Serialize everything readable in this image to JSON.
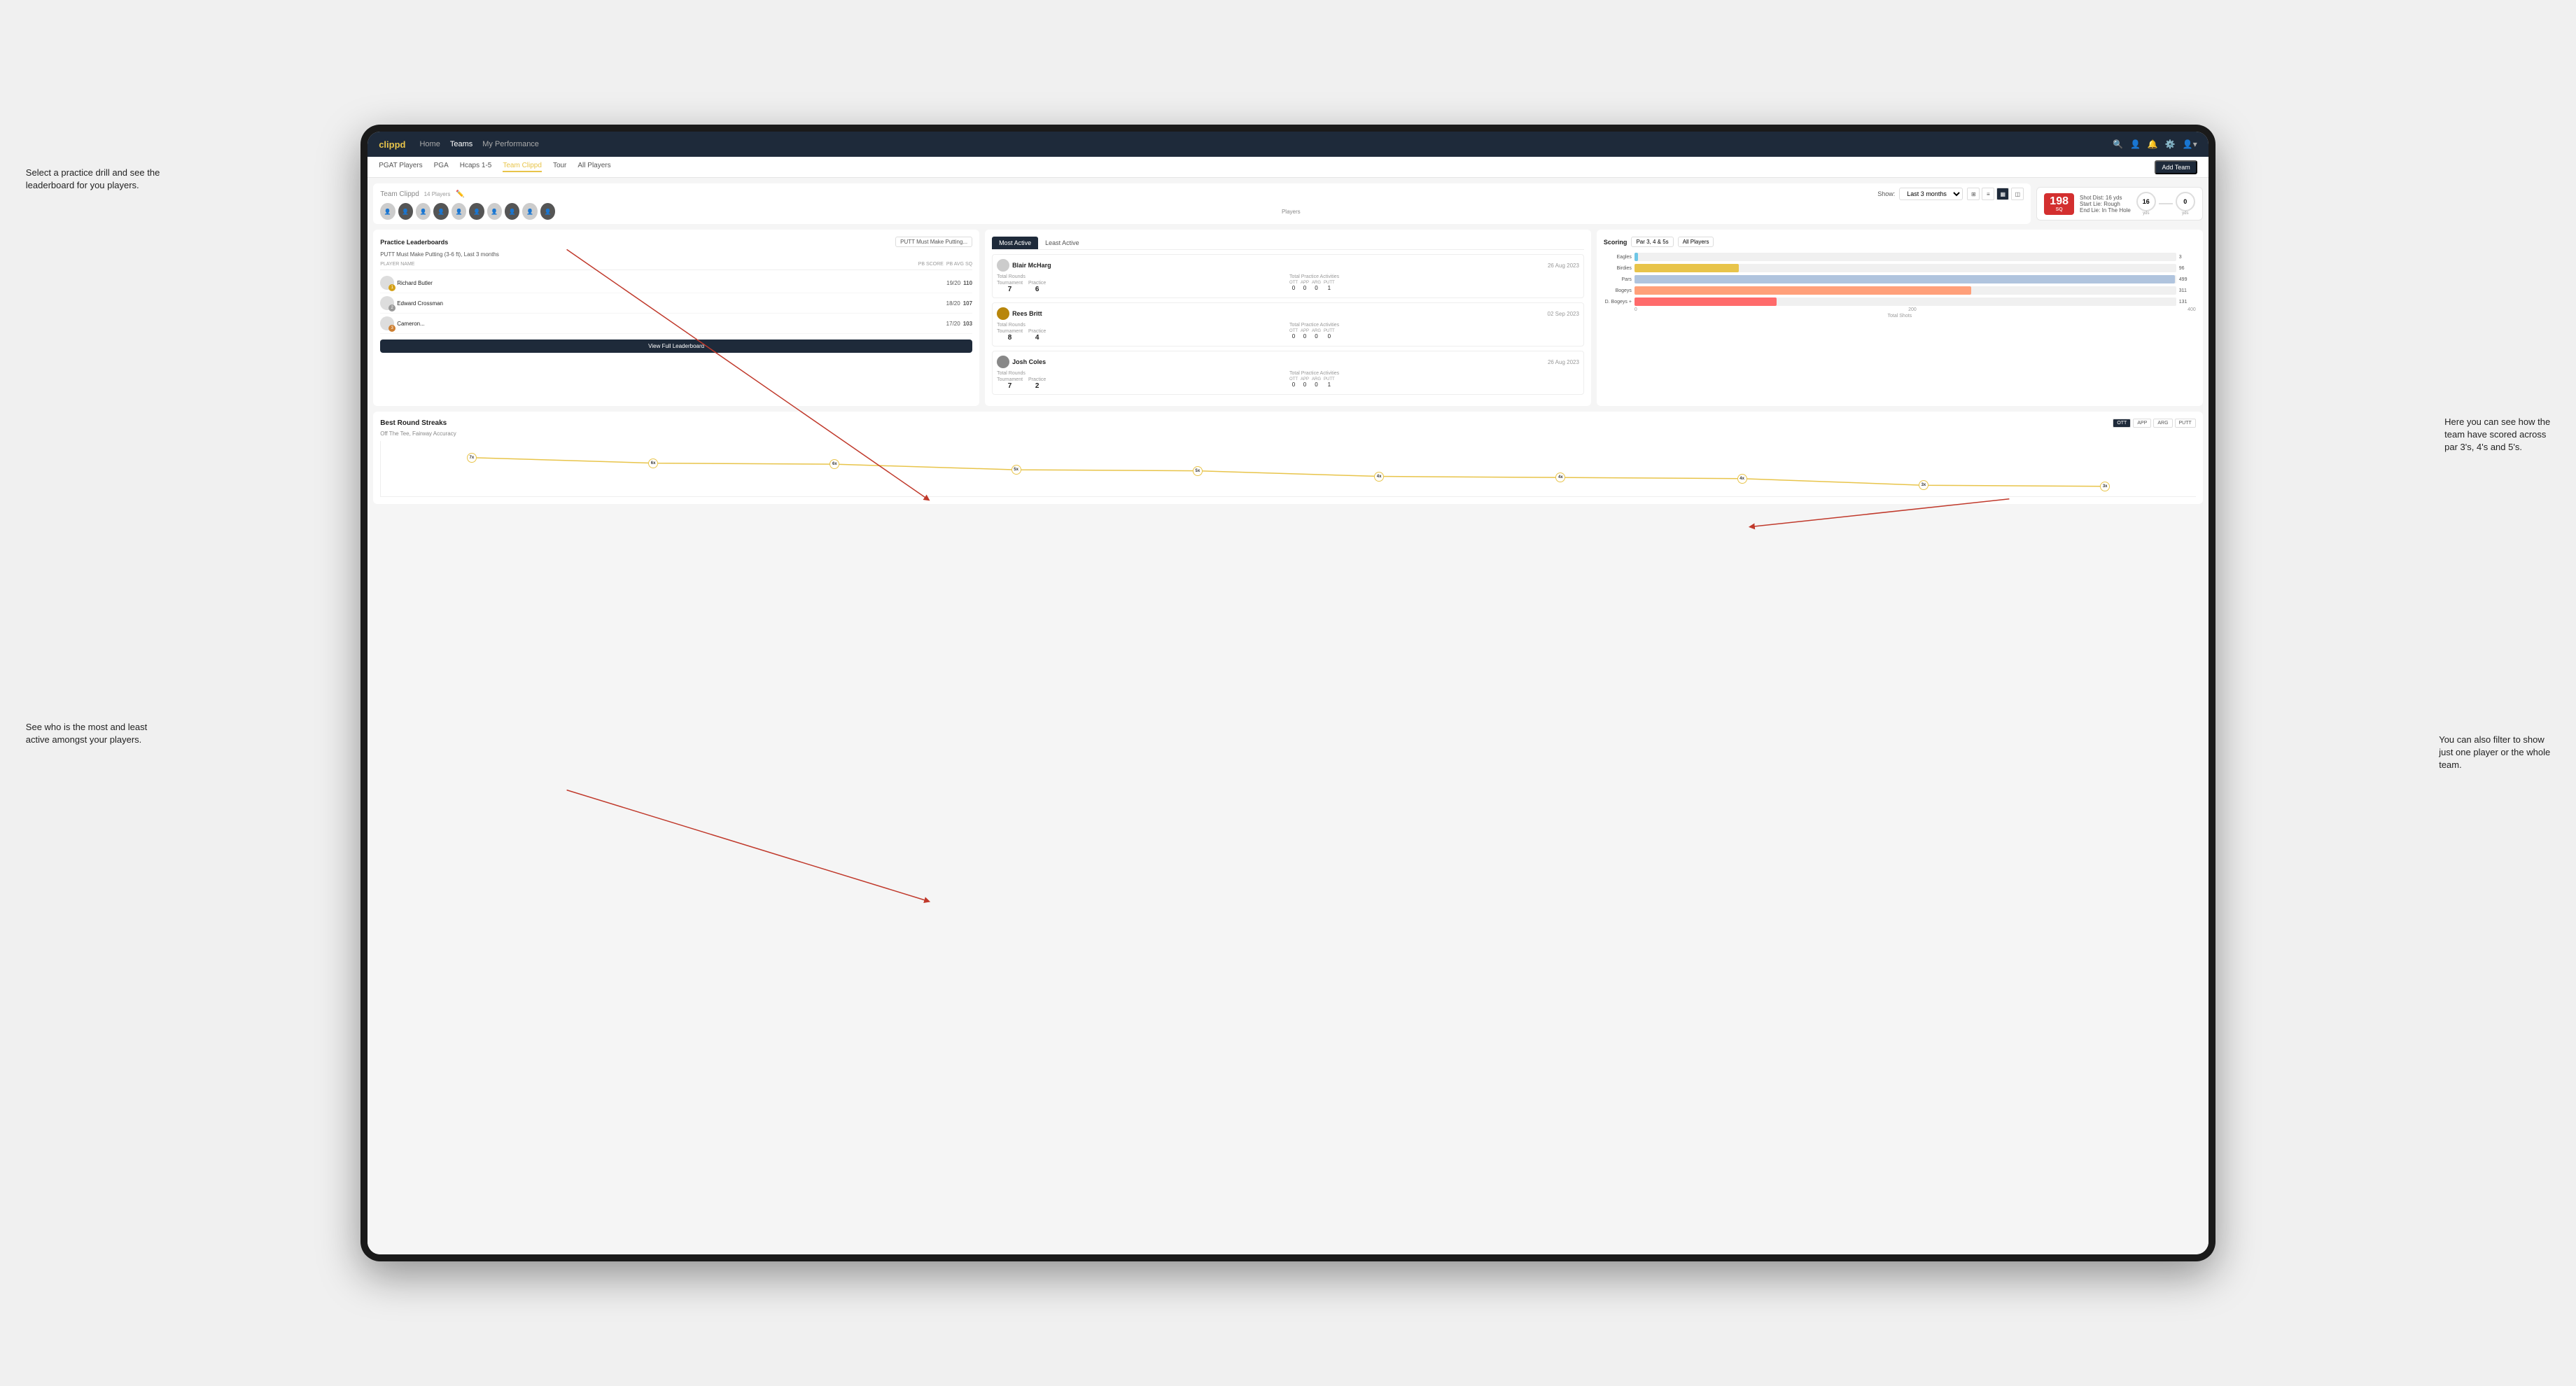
{
  "annotations": {
    "top_left": "Select a practice drill and see the leaderboard for you players.",
    "bottom_left": "See who is the most and least active amongst your players.",
    "top_right_line1": "Here you can see how the",
    "top_right_line2": "team have scored across",
    "top_right_line3": "par 3's, 4's and 5's.",
    "bottom_right_line1": "You can also filter to show",
    "bottom_right_line2": "just one player or the whole",
    "bottom_right_line3": "team."
  },
  "navbar": {
    "brand": "clippd",
    "links": [
      "Home",
      "Teams",
      "My Performance"
    ],
    "active_link": "Teams"
  },
  "subnav": {
    "links": [
      "PGAT Players",
      "PGA",
      "Hcaps 1-5",
      "Team Clippd",
      "Tour",
      "All Players"
    ],
    "active_link": "Team Clippd",
    "add_team_btn": "Add Team"
  },
  "team_header": {
    "title": "Team Clippd",
    "player_count": "14 Players",
    "show_label": "Show:",
    "show_value": "Last 3 months",
    "players_label": "Players"
  },
  "score_display": {
    "number": "198",
    "unit": "SQ",
    "shot_dist": "Shot Dist: 16 yds",
    "start_lie": "Start Lie: Rough",
    "end_lie": "End Lie: In The Hole",
    "circle1_value": "16",
    "circle1_label": "yds",
    "circle2_value": "0",
    "circle2_label": "yds"
  },
  "practice_leaderboard": {
    "title": "Practice Leaderboards",
    "dropdown": "PUTT Must Make Putting...",
    "subtitle": "PUTT Must Make Putting (3-6 ft), Last 3 months",
    "columns": [
      "PLAYER NAME",
      "PB SCORE",
      "PB AVG SQ"
    ],
    "players": [
      {
        "name": "Richard Butler",
        "score": "19/20",
        "avg": "110",
        "badge": "gold",
        "rank": 1
      },
      {
        "name": "Edward Crossman",
        "score": "18/20",
        "avg": "107",
        "badge": "silver",
        "rank": 2
      },
      {
        "name": "Cameron...",
        "score": "17/20",
        "avg": "103",
        "badge": "bronze",
        "rank": 3
      }
    ],
    "view_full_btn": "View Full Leaderboard"
  },
  "activity": {
    "tabs": [
      "Most Active",
      "Least Active"
    ],
    "active_tab": "Most Active",
    "players": [
      {
        "name": "Blair McHarg",
        "date": "26 Aug 2023",
        "total_rounds_label": "Total Rounds",
        "tournament": "7",
        "practice": "6",
        "total_practice_label": "Total Practice Activities",
        "ott": "0",
        "app": "0",
        "arg": "0",
        "putt": "1"
      },
      {
        "name": "Rees Britt",
        "date": "02 Sep 2023",
        "total_rounds_label": "Total Rounds",
        "tournament": "8",
        "practice": "4",
        "total_practice_label": "Total Practice Activities",
        "ott": "0",
        "app": "0",
        "arg": "0",
        "putt": "0"
      },
      {
        "name": "Josh Coles",
        "date": "26 Aug 2023",
        "total_rounds_label": "Total Rounds",
        "tournament": "7",
        "practice": "2",
        "total_practice_label": "Total Practice Activities",
        "ott": "0",
        "app": "0",
        "arg": "0",
        "putt": "1"
      }
    ]
  },
  "scoring": {
    "title": "Scoring",
    "filter1": "Par 3, 4 & 5s",
    "filter2": "All Players",
    "bars": [
      {
        "label": "Eagles",
        "value": 3,
        "max": 500,
        "color": "eagles"
      },
      {
        "label": "Birdies",
        "value": 96,
        "max": 500,
        "color": "birdies"
      },
      {
        "label": "Pars",
        "value": 499,
        "max": 500,
        "color": "pars"
      },
      {
        "label": "Bogeys",
        "value": 311,
        "max": 500,
        "color": "bogeys"
      },
      {
        "label": "D. Bogeys +",
        "value": 131,
        "max": 500,
        "color": "dbogeys"
      }
    ],
    "axis_labels": [
      "0",
      "200",
      "400"
    ],
    "x_label": "Total Shots"
  },
  "streaks": {
    "title": "Best Round Streaks",
    "filter_btns": [
      "OTT",
      "APP",
      "ARG",
      "PUTT"
    ],
    "active_filter": "OTT",
    "subtitle": "Off The Tee, Fairway Accuracy",
    "dots": [
      {
        "x": 7,
        "label": "7x"
      },
      {
        "x": 17,
        "label": "6x"
      },
      {
        "x": 27,
        "label": "6x"
      },
      {
        "x": 37,
        "label": "5x"
      },
      {
        "x": 47,
        "label": "5x"
      },
      {
        "x": 57,
        "label": "4x"
      },
      {
        "x": 67,
        "label": "4x"
      },
      {
        "x": 77,
        "label": "4x"
      },
      {
        "x": 87,
        "label": "3x"
      },
      {
        "x": 97,
        "label": "3x"
      }
    ]
  }
}
